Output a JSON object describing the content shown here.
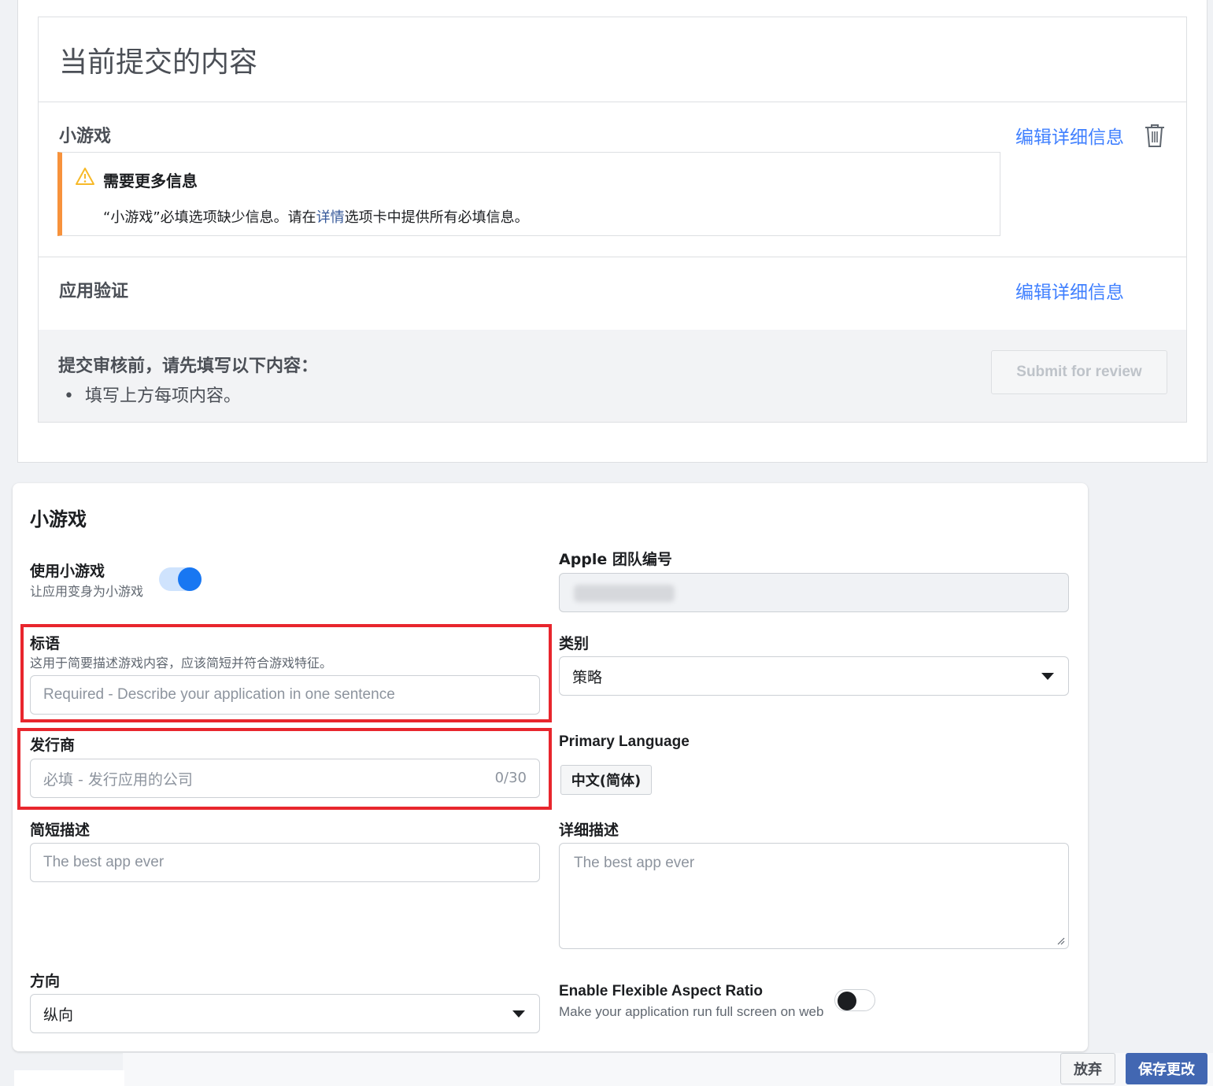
{
  "submission": {
    "title": "当前提交的内容",
    "items": [
      {
        "title": "小游戏",
        "edit_label": "编辑详细信息",
        "warning": {
          "title": "需要更多信息",
          "text_prefix": "“小游戏”必填选项缺少信息。请在",
          "link": "详情",
          "text_suffix": "选项卡中提供所有必填信息。"
        }
      },
      {
        "title": "应用验证",
        "edit_label": "编辑详细信息"
      }
    ],
    "footer": {
      "title": "提交审核前，请先填写以下内容：",
      "bullet": "填写上方每项内容。",
      "submit_label": "Submit for review"
    }
  },
  "settings": {
    "title": "小游戏",
    "use_instant_game": {
      "label": "使用小游戏",
      "sub": "让应用变身为小游戏",
      "enabled": true
    },
    "tagline": {
      "label": "标语",
      "sub": "这用于简要描述游戏内容，应该简短并符合游戏特征。",
      "placeholder": "Required - Describe your application in one sentence"
    },
    "publisher": {
      "label": "发行商",
      "placeholder": "必填 - 发行应用的公司",
      "counter": "0/30"
    },
    "short_description": {
      "label": "简短描述",
      "placeholder": "The best app ever"
    },
    "orientation": {
      "label": "方向",
      "value": "纵向"
    },
    "apple_team_id": {
      "label": "Apple 团队编号"
    },
    "category": {
      "label": "类别",
      "value": "策略"
    },
    "primary_language": {
      "label": "Primary Language",
      "value": "中文(简体)"
    },
    "long_description": {
      "label": "详细描述",
      "placeholder": "The best app ever"
    },
    "flexible_aspect": {
      "label": "Enable Flexible Aspect Ratio",
      "sub": "Make your application run full screen on web",
      "enabled": false
    }
  },
  "actions": {
    "discard_label": "放弃",
    "save_label": "保存更改"
  },
  "colors": {
    "link": "#4080ff",
    "warning_accent": "#f7923b",
    "toggle_on": "#1877f2",
    "save_button": "#4267b2",
    "highlight_box": "#e8262d"
  }
}
